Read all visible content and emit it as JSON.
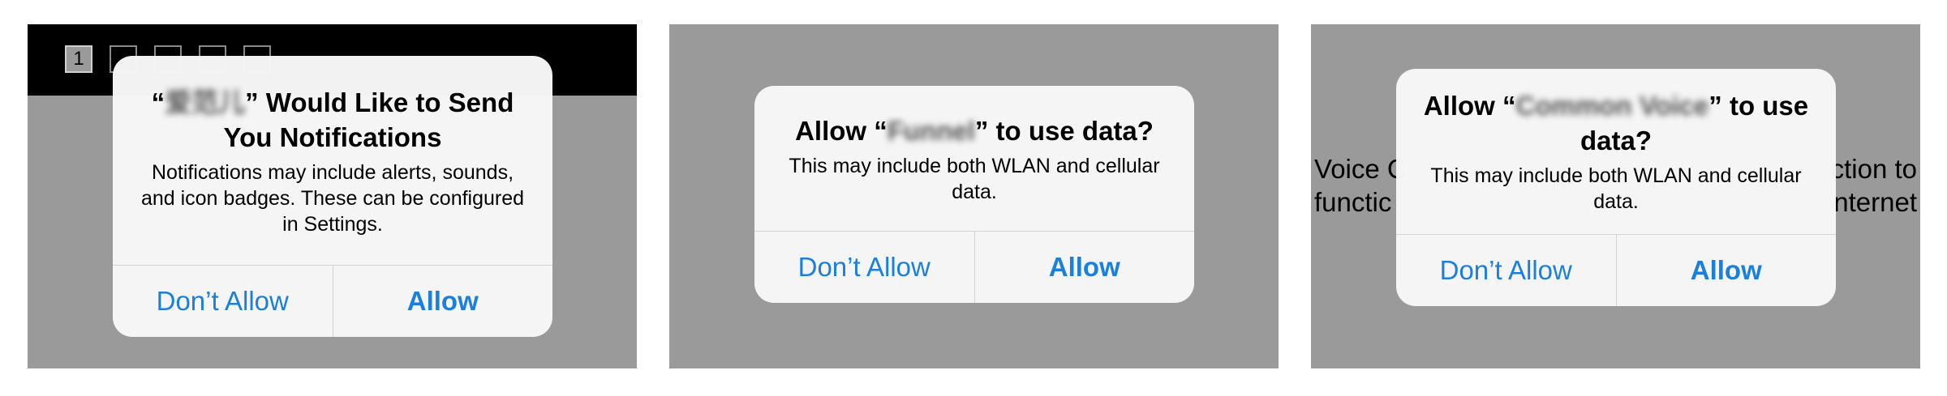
{
  "panels": [
    {
      "page_indicator": [
        "1",
        "",
        "",
        "",
        ""
      ],
      "alert": {
        "title_prefix": "“",
        "title_app": "爱范儿",
        "title_suffix": "” Would Like to Send You Notifications",
        "message": "Notifications may include alerts, sounds, and icon badges. These can be configured in Settings.",
        "deny_label": "Don’t Allow",
        "allow_label": "Allow"
      }
    },
    {
      "alert": {
        "title_prefix": "Allow “",
        "title_app": "Funnel",
        "title_suffix": "” to use data?",
        "message": "This may include both WLAN and cellular data.",
        "deny_label": "Don’t Allow",
        "allow_label": "Allow"
      }
    },
    {
      "background_text": {
        "left_line1": "Voice C",
        "left_line2": "functic",
        "right_line1": "ction to",
        "right_line2": "nternet"
      },
      "alert": {
        "title_prefix": "Allow “",
        "title_app": "Common Voice",
        "title_suffix": "” to use data?",
        "message": "This may include both WLAN and cellular data.",
        "deny_label": "Don’t Allow",
        "allow_label": "Allow"
      }
    }
  ],
  "colors": {
    "overlay": "#9a9a9a",
    "accent": "#1b7fdc",
    "alert_bg": "#f6f6f6",
    "header": "#000000"
  }
}
